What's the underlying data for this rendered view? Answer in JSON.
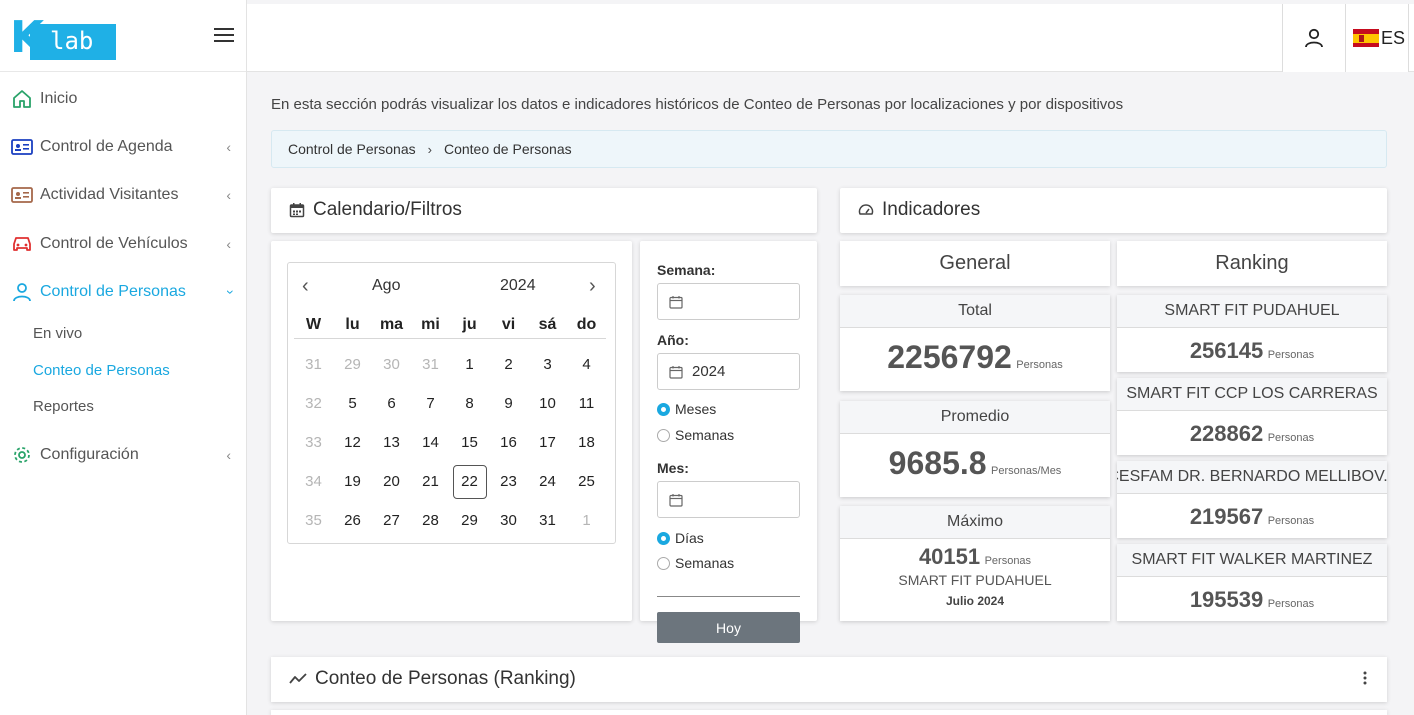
{
  "logo": {
    "letter": "K",
    "text": "lab"
  },
  "sidebar": {
    "items": [
      {
        "label": "Inicio"
      },
      {
        "label": "Control de Agenda"
      },
      {
        "label": "Actividad Visitantes"
      },
      {
        "label": "Control de Vehículos"
      },
      {
        "label": "Control de Personas"
      },
      {
        "label": "Configuración"
      }
    ],
    "submenu": [
      {
        "label": "En vivo"
      },
      {
        "label": "Conteo de Personas"
      },
      {
        "label": "Reportes"
      }
    ]
  },
  "topbar": {
    "lang": "ES"
  },
  "intro": "En esta sección podrás visualizar los datos e indicadores históricos de Conteo de Personas por localizaciones y por dispositivos",
  "breadcrumb": {
    "parent": "Control de Personas",
    "current": "Conteo de Personas"
  },
  "calendar_card": {
    "title": "Calendario/Filtros"
  },
  "calendar": {
    "month": "Ago",
    "year": "2024",
    "weekdays": [
      "W",
      "lu",
      "ma",
      "mi",
      "ju",
      "vi",
      "sá",
      "do"
    ],
    "weeks": [
      [
        "31",
        "29",
        "30",
        "31",
        "1",
        "2",
        "3",
        "4"
      ],
      [
        "32",
        "5",
        "6",
        "7",
        "8",
        "9",
        "10",
        "11"
      ],
      [
        "33",
        "12",
        "13",
        "14",
        "15",
        "16",
        "17",
        "18"
      ],
      [
        "34",
        "19",
        "20",
        "21",
        "22",
        "23",
        "24",
        "25"
      ],
      [
        "35",
        "26",
        "27",
        "28",
        "29",
        "30",
        "31",
        "1"
      ]
    ]
  },
  "filters": {
    "semana_label": "Semana:",
    "semana_value": "",
    "anio_label": "Año:",
    "anio_value": "2024",
    "radio_meses": "Meses",
    "radio_semanas_1": "Semanas",
    "mes_label": "Mes:",
    "mes_value": "",
    "radio_dias": "Días",
    "radio_semanas_2": "Semanas",
    "hoy_button": "Hoy"
  },
  "indicators": {
    "title": "Indicadores",
    "general_label": "General",
    "ranking_label": "Ranking",
    "total": {
      "title": "Total",
      "value": "2256792",
      "unit": "Personas"
    },
    "promedio": {
      "title": "Promedio",
      "value": "9685.8",
      "unit": "Personas/Mes"
    },
    "maximo": {
      "title": "Máximo",
      "value": "40151",
      "unit": "Personas",
      "place": "SMART FIT PUDAHUEL",
      "period": "Julio 2024"
    },
    "ranking": [
      {
        "name": "SMART FIT PUDAHUEL",
        "value": "256145",
        "unit": "Personas"
      },
      {
        "name": "SMART FIT CCP LOS CARRERAS",
        "value": "228862",
        "unit": "Personas"
      },
      {
        "name": "CESFAM DR. BERNARDO MELLIBOV...",
        "value": "219567",
        "unit": "Personas"
      },
      {
        "name": "SMART FIT WALKER MARTINEZ",
        "value": "195539",
        "unit": "Personas"
      }
    ]
  },
  "ranking_card": {
    "title": "Conteo de Personas (Ranking)"
  },
  "colors": {
    "accent": "#1aa8e0",
    "logo": "#1fb0e6",
    "button": "#6c757d"
  }
}
